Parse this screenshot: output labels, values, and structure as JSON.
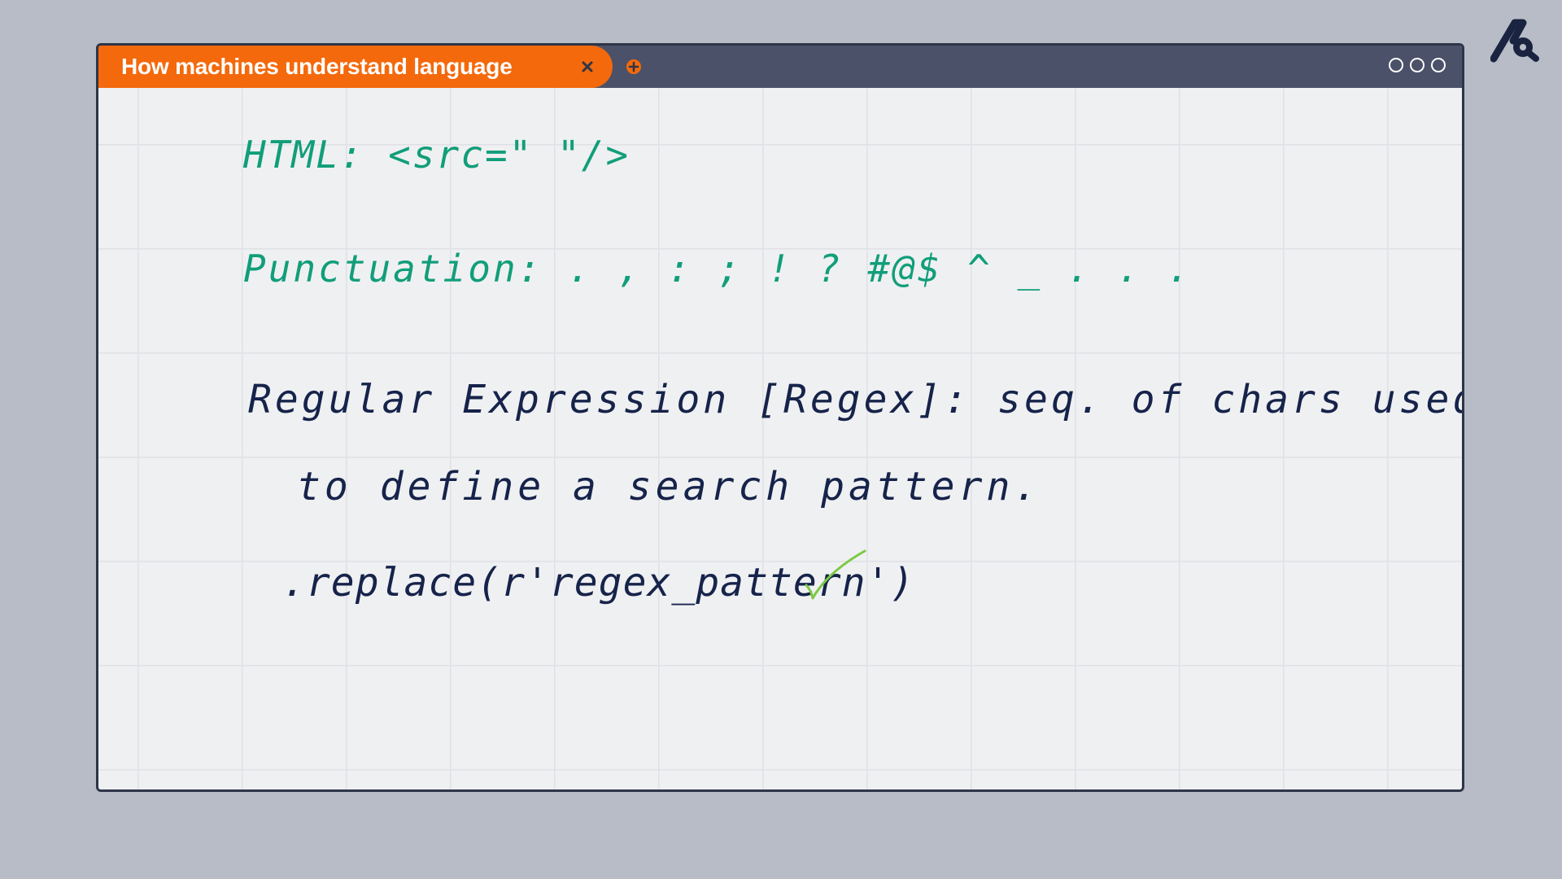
{
  "window": {
    "tab_title": "How machines understand language",
    "tab_close_icon": "close-icon",
    "new_tab_icon": "plus-circle-icon",
    "window_controls": [
      "circle-icon",
      "circle-icon",
      "circle-icon"
    ]
  },
  "logo": {
    "icon": "brand-logo-icon"
  },
  "notes": {
    "line_html": "HTML: <src=\" \"/>",
    "line_punctuation": "Punctuation: . , : ; ! ? #@$ ^ _ . . .",
    "line_regex_1": "Regular Expression [Regex]: seq. of chars used",
    "line_regex_2": "to define a search pattern.",
    "line_replace": ".replace(r'regex_pattern')",
    "checkmark_icon": "checkmark-icon"
  },
  "colors": {
    "tab_orange": "#f4690b",
    "titlebar": "#4a5168",
    "ink_green": "#119e7a",
    "ink_navy": "#16234a",
    "check_green": "#7ac943",
    "background": "#b7bcc6"
  }
}
